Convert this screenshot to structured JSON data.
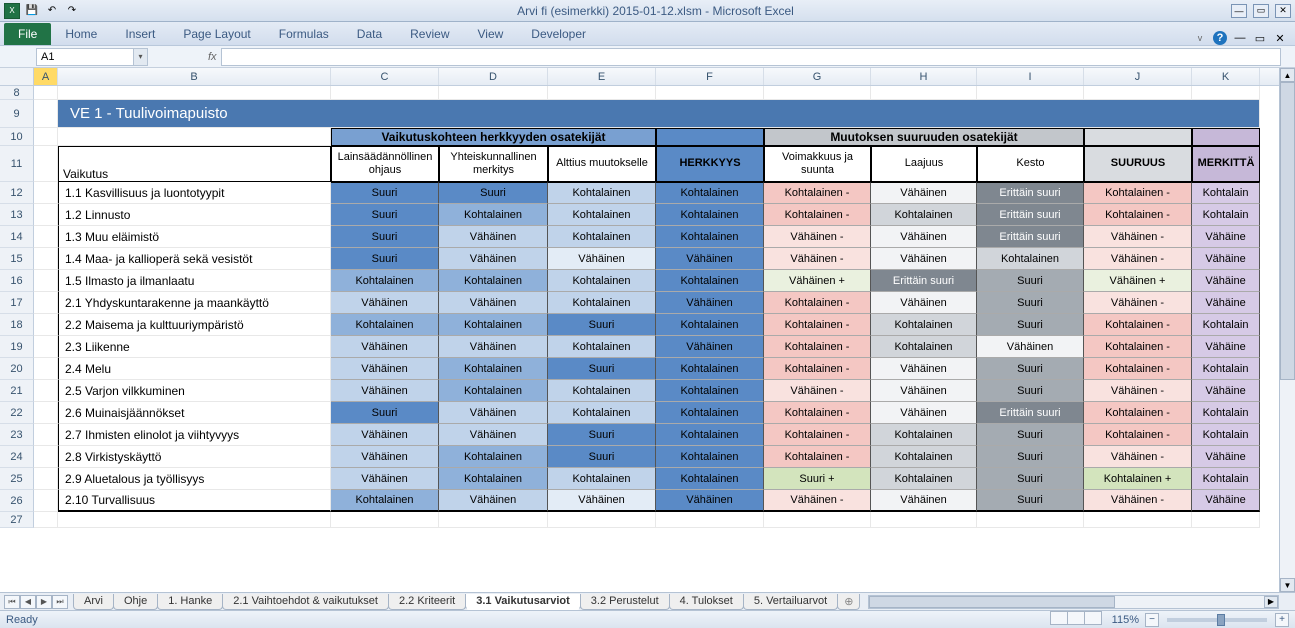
{
  "app": {
    "title": "Arvi fi (esimerkki) 2015-01-12.xlsm  -  Microsoft Excel"
  },
  "ribbon": {
    "file": "File",
    "tabs": [
      "Home",
      "Insert",
      "Page Layout",
      "Formulas",
      "Data",
      "Review",
      "View",
      "Developer"
    ]
  },
  "namebox": "A1",
  "cols": [
    "A",
    "B",
    "C",
    "D",
    "E",
    "F",
    "G",
    "H",
    "I",
    "J",
    "K"
  ],
  "rows_hdr": [
    "8",
    "9",
    "10",
    "11",
    "12",
    "13",
    "14",
    "15",
    "16",
    "17",
    "18",
    "19",
    "20",
    "21",
    "22",
    "23",
    "24",
    "25",
    "26",
    "27"
  ],
  "banner": "VE 1 - Tuulivoimapuisto",
  "grouphdr": {
    "f": "Vaikutuskohteen herkkyyden osatekijät",
    "m": "Muutoksen suuruuden osatekijät"
  },
  "subhdr": {
    "vaikutus": "Vaikutus",
    "c": "Lainsäädännöllinen ohjaus",
    "d": "Yhteiskunnallinen merkitys",
    "e": "Alttius muutokselle",
    "f": "HERKKYYS",
    "g": "Voimakkuus ja suunta",
    "h": "Laajuus",
    "i": "Kesto",
    "j": "SUURUUS",
    "k": "MERKITTÄ"
  },
  "rows": [
    {
      "lbl": "1.1 Kasvillisuus ja luontotyypit",
      "c": "Suuri",
      "cc": "c-b1",
      "d": "Suuri",
      "dc": "c-b1",
      "e": "Kohtalainen",
      "ec": "c-b3",
      "f": "Kohtalainen",
      "g": "Kohtalainen -",
      "gc": "c-r1",
      "h": "Vähäinen",
      "hc": "c-gr4",
      "i": "Erittäin suuri",
      "ic": "c-gr1",
      "j": "Kohtalainen -",
      "jc": "c-r1",
      "k": "Kohtalain"
    },
    {
      "lbl": "1.2 Linnusto",
      "c": "Suuri",
      "cc": "c-b1",
      "d": "Kohtalainen",
      "dc": "c-b2",
      "e": "Kohtalainen",
      "ec": "c-b3",
      "f": "Kohtalainen",
      "g": "Kohtalainen -",
      "gc": "c-r1",
      "h": "Kohtalainen",
      "hc": "c-gr3",
      "i": "Erittäin suuri",
      "ic": "c-gr1",
      "j": "Kohtalainen -",
      "jc": "c-r1",
      "k": "Kohtalain"
    },
    {
      "lbl": "1.3 Muu eläimistö",
      "c": "Suuri",
      "cc": "c-b1",
      "d": "Vähäinen",
      "dc": "c-b3",
      "e": "Kohtalainen",
      "ec": "c-b3",
      "f": "Kohtalainen",
      "g": "Vähäinen -",
      "gc": "c-r2",
      "h": "Vähäinen",
      "hc": "c-gr4",
      "i": "Erittäin suuri",
      "ic": "c-gr1",
      "j": "Vähäinen -",
      "jc": "c-r2",
      "k": "Vähäine"
    },
    {
      "lbl": "1.4 Maa- ja kallioperä sekä vesistöt",
      "c": "Suuri",
      "cc": "c-b1",
      "d": "Vähäinen",
      "dc": "c-b3",
      "e": "Vähäinen",
      "ec": "c-b4",
      "f": "Vähäinen",
      "g": "Vähäinen -",
      "gc": "c-r2",
      "h": "Vähäinen",
      "hc": "c-gr4",
      "i": "Kohtalainen",
      "ic": "c-gr3",
      "j": "Vähäinen -",
      "jc": "c-r2",
      "k": "Vähäine"
    },
    {
      "lbl": "1.5 Ilmasto ja ilmanlaatu",
      "c": "Kohtalainen",
      "cc": "c-b2",
      "d": "Kohtalainen",
      "dc": "c-b2",
      "e": "Kohtalainen",
      "ec": "c-b3",
      "f": "Kohtalainen",
      "g": "Vähäinen +",
      "gc": "c-g2",
      "h": "Erittäin suuri",
      "hc": "c-gr1",
      "i": "Suuri",
      "ic": "c-gr2",
      "j": "Vähäinen +",
      "jc": "c-g2",
      "k": "Vähäine"
    },
    {
      "lbl": "2.1 Yhdyskuntarakenne ja maankäyttö",
      "c": "Vähäinen",
      "cc": "c-b3",
      "d": "Vähäinen",
      "dc": "c-b3",
      "e": "Kohtalainen",
      "ec": "c-b3",
      "f": "Vähäinen",
      "g": "Kohtalainen -",
      "gc": "c-r1",
      "h": "Vähäinen",
      "hc": "c-gr4",
      "i": "Suuri",
      "ic": "c-gr2",
      "j": "Vähäinen -",
      "jc": "c-r2",
      "k": "Vähäine"
    },
    {
      "lbl": "2.2 Maisema ja kulttuuriympäristö",
      "c": "Kohtalainen",
      "cc": "c-b2",
      "d": "Kohtalainen",
      "dc": "c-b2",
      "e": "Suuri",
      "ec": "c-b1",
      "f": "Kohtalainen",
      "g": "Kohtalainen -",
      "gc": "c-r1",
      "h": "Kohtalainen",
      "hc": "c-gr3",
      "i": "Suuri",
      "ic": "c-gr2",
      "j": "Kohtalainen -",
      "jc": "c-r1",
      "k": "Kohtalain"
    },
    {
      "lbl": "2.3 Liikenne",
      "c": "Vähäinen",
      "cc": "c-b3",
      "d": "Vähäinen",
      "dc": "c-b3",
      "e": "Kohtalainen",
      "ec": "c-b3",
      "f": "Vähäinen",
      "g": "Kohtalainen -",
      "gc": "c-r1",
      "h": "Kohtalainen",
      "hc": "c-gr3",
      "i": "Vähäinen",
      "ic": "c-gr4",
      "j": "Kohtalainen -",
      "jc": "c-r1",
      "k": "Vähäine"
    },
    {
      "lbl": "2.4 Melu",
      "c": "Vähäinen",
      "cc": "c-b3",
      "d": "Kohtalainen",
      "dc": "c-b2",
      "e": "Suuri",
      "ec": "c-b1",
      "f": "Kohtalainen",
      "g": "Kohtalainen -",
      "gc": "c-r1",
      "h": "Vähäinen",
      "hc": "c-gr4",
      "i": "Suuri",
      "ic": "c-gr2",
      "j": "Kohtalainen -",
      "jc": "c-r1",
      "k": "Kohtalain"
    },
    {
      "lbl": "2.5 Varjon vilkkuminen",
      "c": "Vähäinen",
      "cc": "c-b3",
      "d": "Kohtalainen",
      "dc": "c-b2",
      "e": "Kohtalainen",
      "ec": "c-b3",
      "f": "Kohtalainen",
      "g": "Vähäinen -",
      "gc": "c-r2",
      "h": "Vähäinen",
      "hc": "c-gr4",
      "i": "Suuri",
      "ic": "c-gr2",
      "j": "Vähäinen -",
      "jc": "c-r2",
      "k": "Vähäine"
    },
    {
      "lbl": "2.6 Muinaisjäännökset",
      "c": "Suuri",
      "cc": "c-b1",
      "d": "Vähäinen",
      "dc": "c-b3",
      "e": "Kohtalainen",
      "ec": "c-b3",
      "f": "Kohtalainen",
      "g": "Kohtalainen -",
      "gc": "c-r1",
      "h": "Vähäinen",
      "hc": "c-gr4",
      "i": "Erittäin suuri",
      "ic": "c-gr1",
      "j": "Kohtalainen -",
      "jc": "c-r1",
      "k": "Kohtalain"
    },
    {
      "lbl": "2.7 Ihmisten elinolot ja viihtyvyys",
      "c": "Vähäinen",
      "cc": "c-b3",
      "d": "Vähäinen",
      "dc": "c-b3",
      "e": "Suuri",
      "ec": "c-b1",
      "f": "Kohtalainen",
      "g": "Kohtalainen -",
      "gc": "c-r1",
      "h": "Kohtalainen",
      "hc": "c-gr3",
      "i": "Suuri",
      "ic": "c-gr2",
      "j": "Kohtalainen -",
      "jc": "c-r1",
      "k": "Kohtalain"
    },
    {
      "lbl": "2.8 Virkistyskäyttö",
      "c": "Vähäinen",
      "cc": "c-b3",
      "d": "Kohtalainen",
      "dc": "c-b2",
      "e": "Suuri",
      "ec": "c-b1",
      "f": "Kohtalainen",
      "g": "Kohtalainen -",
      "gc": "c-r1",
      "h": "Kohtalainen",
      "hc": "c-gr3",
      "i": "Suuri",
      "ic": "c-gr2",
      "j": "Vähäinen -",
      "jc": "c-r2",
      "k": "Vähäine"
    },
    {
      "lbl": "2.9 Aluetalous ja työllisyys",
      "c": "Vähäinen",
      "cc": "c-b3",
      "d": "Kohtalainen",
      "dc": "c-b2",
      "e": "Kohtalainen",
      "ec": "c-b3",
      "f": "Kohtalainen",
      "g": "Suuri +",
      "gc": "c-g1",
      "h": "Kohtalainen",
      "hc": "c-gr3",
      "i": "Suuri",
      "ic": "c-gr2",
      "j": "Kohtalainen +",
      "jc": "c-g1",
      "k": "Kohtalain"
    },
    {
      "lbl": "2.10 Turvallisuus",
      "c": "Kohtalainen",
      "cc": "c-b2",
      "d": "Vähäinen",
      "dc": "c-b3",
      "e": "Vähäinen",
      "ec": "c-b4",
      "f": "Vähäinen",
      "g": "Vähäinen -",
      "gc": "c-r2",
      "h": "Vähäinen",
      "hc": "c-gr4",
      "i": "Suuri",
      "ic": "c-gr2",
      "j": "Vähäinen -",
      "jc": "c-r2",
      "k": "Vähäine"
    }
  ],
  "tabs": [
    "Arvi",
    "Ohje",
    "1. Hanke",
    "2.1 Vaihtoehdot & vaikutukset",
    "2.2 Kriteerit",
    "3.1 Vaikutusarviot",
    "3.2 Perustelut",
    "4. Tulokset",
    "5. Vertailuarvot"
  ],
  "active_tab": 5,
  "status": {
    "ready": "Ready",
    "zoom": "115%"
  }
}
